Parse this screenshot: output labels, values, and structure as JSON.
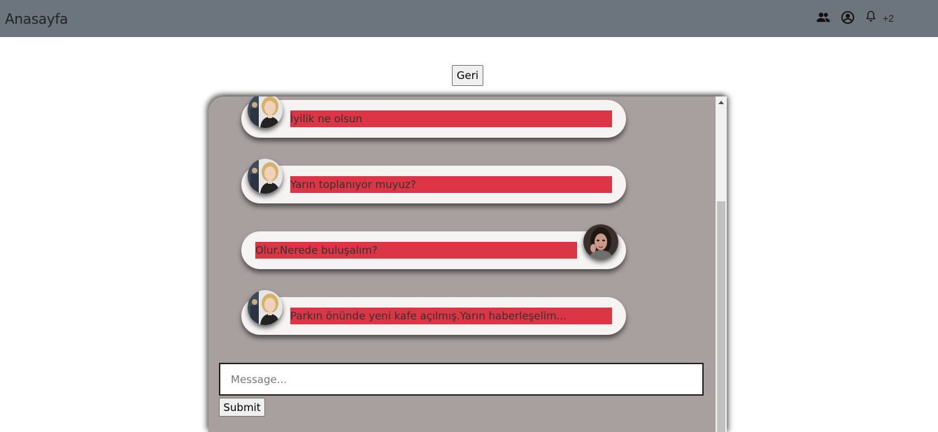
{
  "navbar": {
    "brand": "Anasayfa",
    "icons": [
      "people-icon",
      "user-circle-icon",
      "bell-icon"
    ],
    "notification_badge": "+2"
  },
  "back_button": "Geri",
  "messages": [
    {
      "direction": "incoming",
      "text": "İyilik ne olsun",
      "avatar": "woman-blonde-avatar"
    },
    {
      "direction": "incoming",
      "text": "Yarın toplanıyor muyuz?",
      "avatar": "woman-blonde-avatar"
    },
    {
      "direction": "outgoing",
      "text": "Olur.Nerede buluşalım?",
      "avatar": "woman-dark-hair-avatar"
    },
    {
      "direction": "incoming",
      "text": "Parkın önünde yeni kafe açılmış.Yarın haberleşelim...",
      "avatar": "woman-blonde-avatar"
    }
  ],
  "composer": {
    "placeholder": "Message...",
    "value": "",
    "submit_label": "Submit"
  },
  "colors": {
    "navbar": "#6c757d",
    "chat_panel": "#a8a09f",
    "bubble": "#f6f3f3",
    "message_highlight": "#dc3545"
  }
}
